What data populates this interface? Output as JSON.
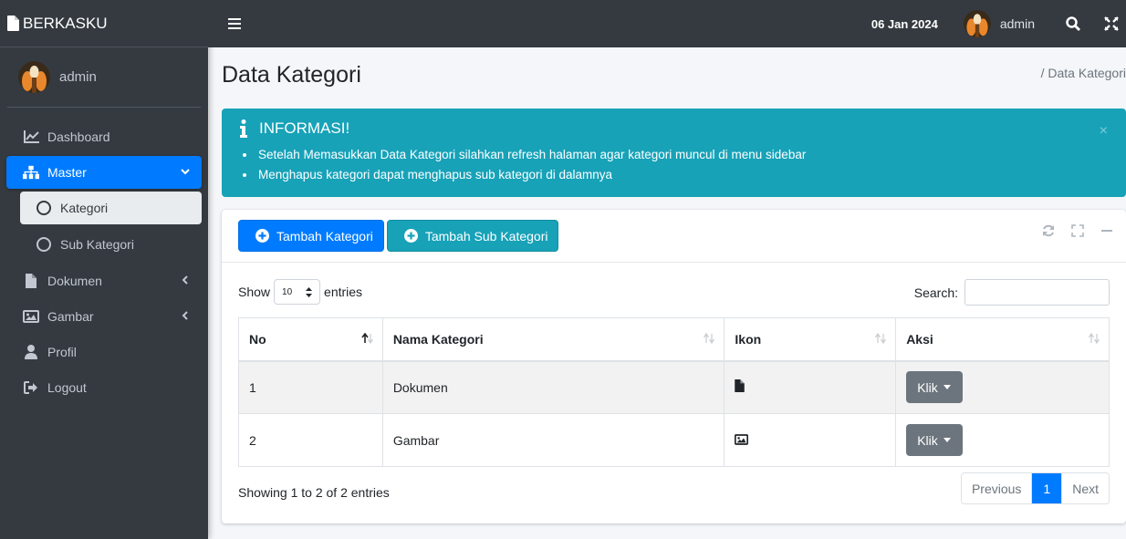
{
  "brand": {
    "name": "BERKASKU"
  },
  "sidebar": {
    "user": "admin",
    "items": [
      {
        "label": "Dashboard",
        "icon": "chart-icon"
      },
      {
        "label": "Master",
        "icon": "sitemap-icon"
      },
      {
        "label": "Kategori",
        "icon": "circle-icon"
      },
      {
        "label": "Sub Kategori",
        "icon": "circle-icon"
      },
      {
        "label": "Dokumen",
        "icon": "file-icon"
      },
      {
        "label": "Gambar",
        "icon": "image-icon"
      },
      {
        "label": "Profil",
        "icon": "user-icon"
      },
      {
        "label": "Logout",
        "icon": "sign-out-icon"
      }
    ]
  },
  "topbar": {
    "date": "06 Jan 2024",
    "user": "admin"
  },
  "page": {
    "title": "Data Kategori",
    "breadcrumb": "/ Data Kategori"
  },
  "alert": {
    "title": "INFORMASI!",
    "close": "×",
    "lines": [
      "Setelah Memasukkan Data Kategori silahkan refresh halaman agar kategori muncul di menu sidebar",
      "Menghapus kategori dapat menghapus sub kategori di dalamnya"
    ]
  },
  "card": {
    "add_category": "Tambah Kategori",
    "add_subcategory": "Tambah Sub Kategori"
  },
  "table": {
    "show_label": "Show",
    "entries_label": "entries",
    "page_length": "10",
    "search_label": "Search:",
    "headers": [
      "No",
      "Nama Kategori",
      "Ikon",
      "Aksi"
    ],
    "rows": [
      {
        "no": "1",
        "name": "Dokumen",
        "icon": "file-icon",
        "action": "Klik"
      },
      {
        "no": "2",
        "name": "Gambar",
        "icon": "image-icon",
        "action": "Klik"
      }
    ],
    "info": "Showing 1 to 2 of 2 entries",
    "pagination": {
      "previous": "Previous",
      "current": "1",
      "next": "Next"
    }
  },
  "colors": {
    "primary": "#007bff",
    "info": "#17a2b8",
    "sidebar": "#343a40",
    "secondary": "#6c757d"
  }
}
